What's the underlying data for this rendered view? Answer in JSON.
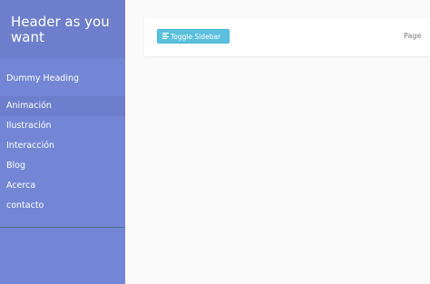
{
  "sidebar": {
    "header_title": "Header as you want",
    "dummy_heading": "Dummy Heading",
    "items": [
      {
        "label": "Animación"
      },
      {
        "label": "Ilustración"
      },
      {
        "label": "Interacción"
      },
      {
        "label": "Blog"
      },
      {
        "label": "Acerca"
      },
      {
        "label": "contacto"
      }
    ]
  },
  "navbar": {
    "toggle_label": "Toggle Sidebar",
    "toggle_icon": "align-left-icon",
    "page_link": "Page"
  },
  "colors": {
    "sidebar_bg": "#7386d5",
    "sidebar_header_bg": "#6d7fcc",
    "toggle_button": "#5bc0de",
    "content_bg": "#fafafa"
  }
}
